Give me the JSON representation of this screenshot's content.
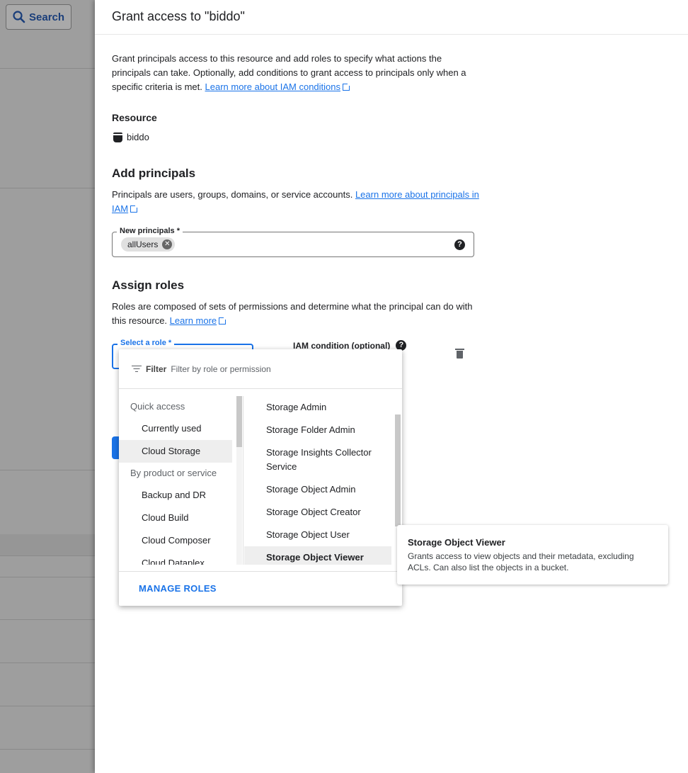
{
  "background": {
    "search_label": "Search"
  },
  "panel": {
    "title": "Grant access to \"biddo\"",
    "intro_text": "Grant principals access to this resource and add roles to specify what actions the principals can take. Optionally, add conditions to grant access to principals only when a specific criteria is met.",
    "intro_link": "Learn more about IAM conditions",
    "resource_heading": "Resource",
    "resource_name": "biddo",
    "add_heading": "Add principals",
    "add_desc": "Principals are users, groups, domains, or service accounts.",
    "add_link": "Learn more about principals in IAM",
    "principals_label": "New principals *",
    "principal_chip": "allUsers",
    "assign_heading": "Assign roles",
    "assign_desc": "Roles are composed of sets of permissions and determine what the principal can do with this resource.",
    "assign_link": "Learn more",
    "role_label": "Select a role *",
    "iam_condition_label": "IAM condition (optional)"
  },
  "dropdown": {
    "filter_word": "Filter",
    "filter_placeholder": "Filter by role or permission",
    "groups": {
      "quick_access": "Quick access",
      "by_product": "By product or service"
    },
    "quick_items": [
      "Currently used",
      "Cloud Storage"
    ],
    "product_items": [
      "Backup and DR",
      "Cloud Build",
      "Cloud Composer",
      "Cloud Dataplex"
    ],
    "selected_category": "Cloud Storage",
    "roles": [
      "Storage Admin",
      "Storage Folder Admin",
      "Storage Insights Collector Service",
      "Storage Object Admin",
      "Storage Object Creator",
      "Storage Object User",
      "Storage Object Viewer"
    ],
    "highlighted_role": "Storage Object Viewer",
    "manage_roles": "MANAGE ROLES"
  },
  "tooltip": {
    "title": "Storage Object Viewer",
    "description": "Grants access to view objects and their metadata, excluding ACLs. Can also list the objects in a bucket."
  },
  "colors": {
    "accent": "#1a73e8",
    "overlay": "#9e9e9e"
  }
}
